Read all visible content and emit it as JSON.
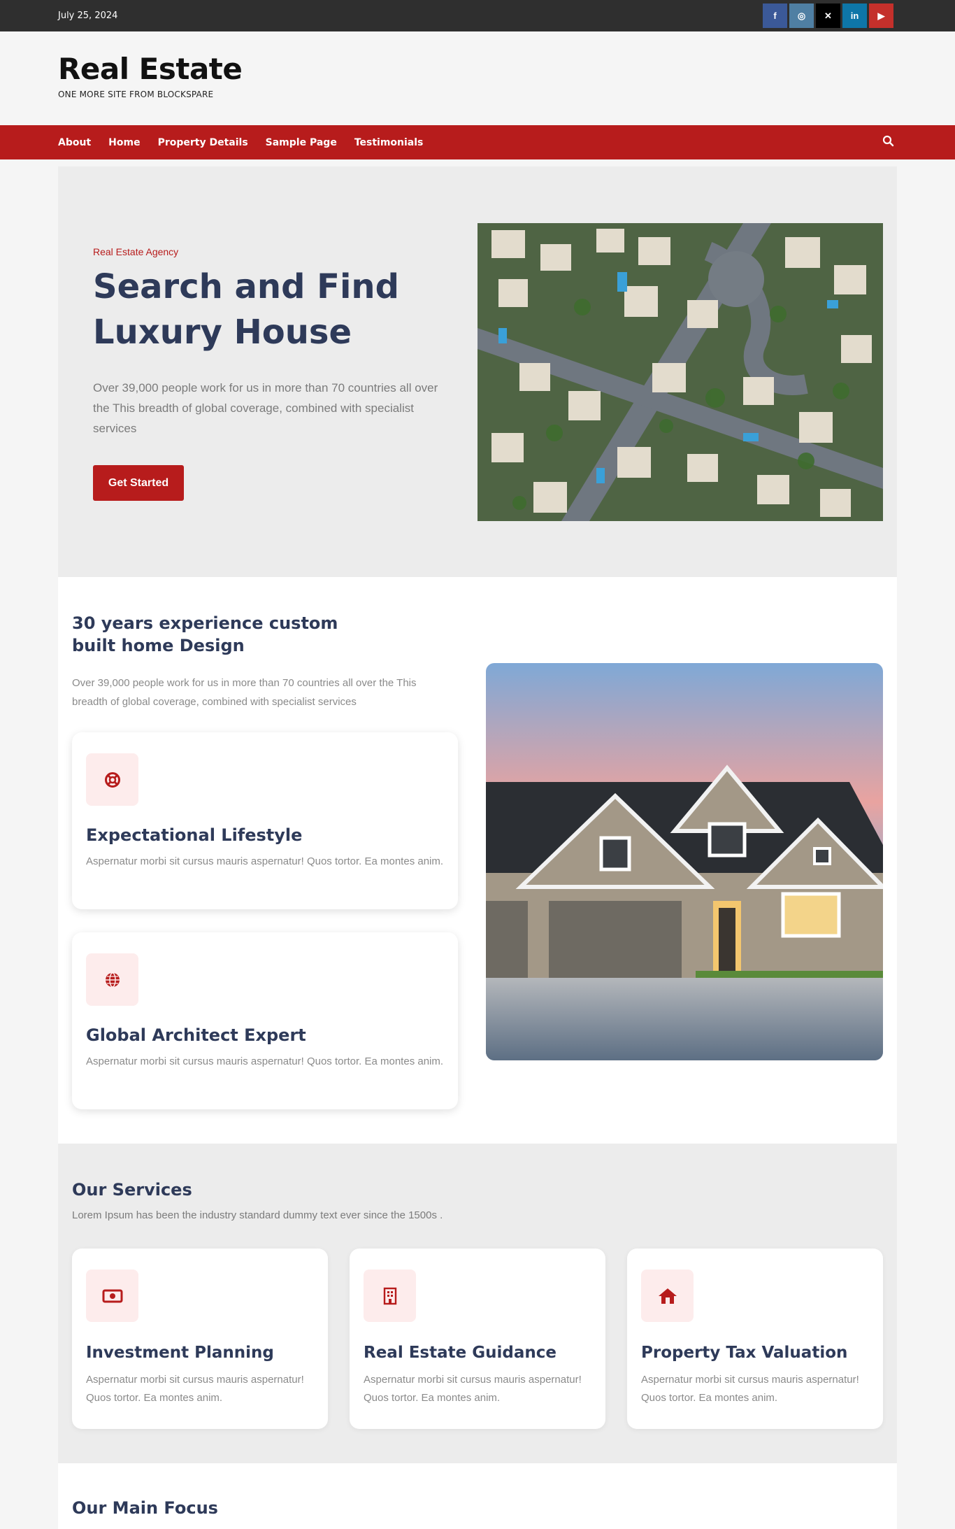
{
  "topbar": {
    "date": "July 25, 2024",
    "social": [
      {
        "name": "facebook-icon",
        "glyph": "f"
      },
      {
        "name": "instagram-icon",
        "glyph": "◎"
      },
      {
        "name": "x-icon",
        "glyph": "✕"
      },
      {
        "name": "linkedin-icon",
        "glyph": "in"
      },
      {
        "name": "youtube-icon",
        "glyph": "▶"
      }
    ]
  },
  "header": {
    "title": "Real Estate",
    "tagline": "ONE MORE SITE FROM BLOCKSPARE"
  },
  "nav": {
    "items": [
      "About",
      "Home",
      "Property Details",
      "Sample Page",
      "Testimonials"
    ],
    "search_icon": "search-icon"
  },
  "hero": {
    "eyebrow": "Real Estate Agency",
    "title": "Search and Find Luxury House",
    "description": "Over 39,000 people work for us in more than 70 countries all over the This breadth of global coverage, combined with specialist services",
    "button": "Get Started"
  },
  "about": {
    "title": "30 years experience custom built home Design",
    "description": "Over 39,000 people work for us in more than 70 countries all over the This breadth of global coverage, combined with specialist services",
    "features": [
      {
        "icon": "lifebuoy-icon",
        "title": "Expectational Lifestyle",
        "text": "Aspernatur morbi sit cursus mauris aspernatur! Quos tortor. Ea montes anim."
      },
      {
        "icon": "globe-icon",
        "title": "Global Architect Expert",
        "text": "Aspernatur morbi sit cursus mauris aspernatur! Quos tortor. Ea montes anim."
      }
    ]
  },
  "services": {
    "title": "Our Services",
    "subtitle": "Lorem Ipsum has been the industry standard dummy text ever since the 1500s .",
    "items": [
      {
        "icon": "money-icon",
        "title": "Investment Planning",
        "text": "Aspernatur morbi sit cursus mauris aspernatur! Quos tortor. Ea montes anim."
      },
      {
        "icon": "building-icon",
        "title": "Real Estate Guidance",
        "text": "Aspernatur morbi sit cursus mauris aspernatur! Quos tortor. Ea montes anim."
      },
      {
        "icon": "house-icon",
        "title": "Property Tax Valuation",
        "text": "Aspernatur morbi sit cursus mauris aspernatur! Quos tortor. Ea montes anim."
      }
    ]
  },
  "focus": {
    "title": "Our Main Focus"
  },
  "colors": {
    "accent": "#b71c1c",
    "heading": "#2e3a59",
    "topbar": "#2f2f2f"
  }
}
